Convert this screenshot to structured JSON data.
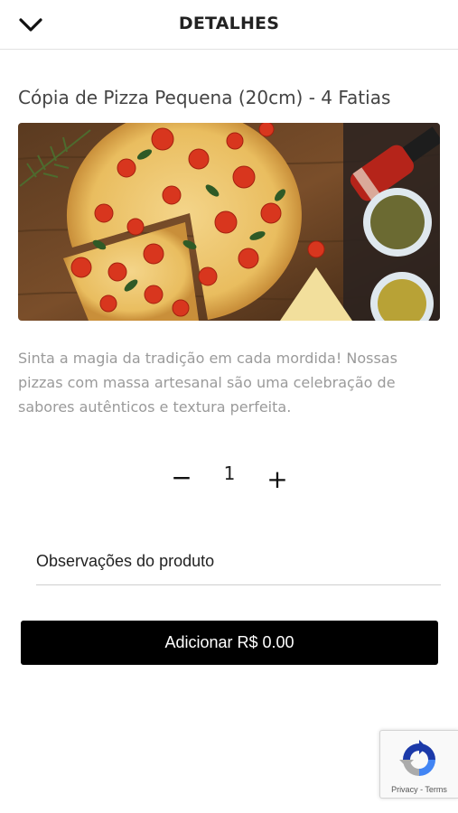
{
  "header": {
    "title": "DETALHES",
    "back_icon": "chevron-down-icon"
  },
  "product": {
    "title": "Cópia de Pizza Pequena (20cm) - 4 Fatias",
    "image_alt": "pizza-photo",
    "description": "Sinta a magia da tradição em cada mordida! Nossas pizzas com massa artesanal são uma celebração de sabores autênticos e textura perfeita."
  },
  "quantity": {
    "minus_label": "−",
    "value": "1",
    "plus_label": "+"
  },
  "notes": {
    "placeholder": "Observações do produto",
    "value": ""
  },
  "add_button": {
    "label": "Adicionar R$ 0.00"
  },
  "recaptcha": {
    "privacy": "Privacy",
    "separator": " - ",
    "terms": "Terms"
  },
  "colors": {
    "button_bg": "#000000",
    "button_text": "#ffffff",
    "description_text": "#9a9a9a"
  }
}
